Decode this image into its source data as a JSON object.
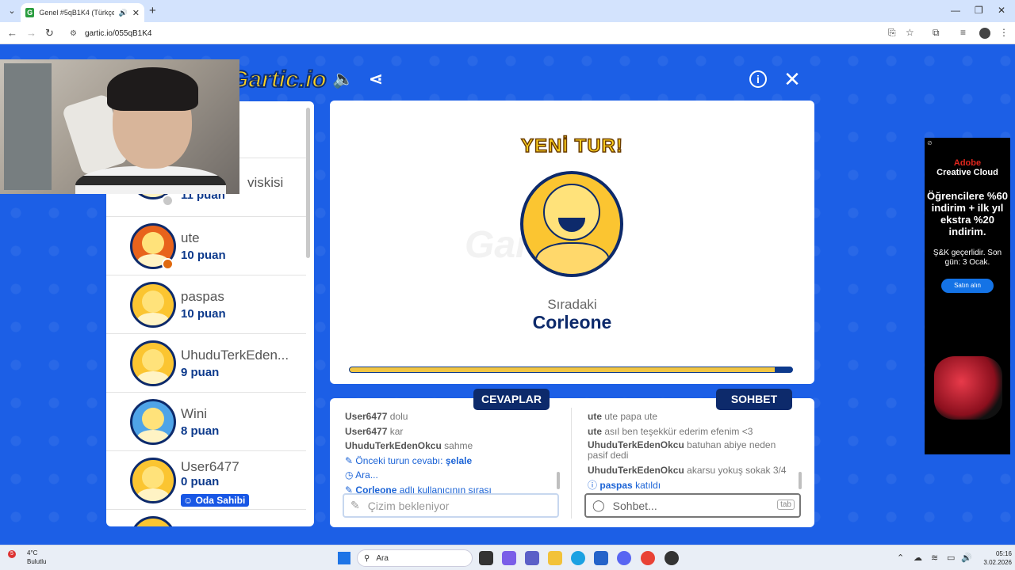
{
  "browser": {
    "tab_title": "Genel #5qB1K4 (Türkçe) - G",
    "url": "gartic.io/055qB1K4"
  },
  "game": {
    "logo": "Gartic.io",
    "players": [
      {
        "name": "",
        "name_suffix": "viskisi",
        "score": "11 puan",
        "avatar": "yellow",
        "status_color": "#c8c8c8"
      },
      {
        "name": "ute",
        "score": "10 puan",
        "avatar": "orange",
        "status_color": "#e06a10"
      },
      {
        "name": "paspas",
        "score": "10 puan",
        "avatar": "yellow",
        "status_color": ""
      },
      {
        "name": "UhuduTerkEden...",
        "score": "9 puan",
        "avatar": "yellow",
        "status_color": ""
      },
      {
        "name": "Wini",
        "score": "8 puan",
        "avatar": "blue",
        "status_color": ""
      },
      {
        "name": "User6477",
        "score": "0 puan",
        "avatar": "yellow",
        "status_color": "",
        "badge": "Oda Sahibi"
      }
    ],
    "round": {
      "title": "YENİ TUR!",
      "next_label": "Sıradaki",
      "next_player": "Corleone",
      "progress": 0.96
    },
    "answers": {
      "tab_label": "CEVAPLAR",
      "lines": [
        {
          "user": "User6477",
          "text": "dolu"
        },
        {
          "user": "User6477",
          "text": "kar"
        },
        {
          "user": "UhuduTerkEdenOkcu",
          "text": "sahme"
        }
      ],
      "prev_answer_prefix": "Önceki turun cevabı:",
      "prev_answer": "şelale",
      "hint": "Ara...",
      "turn_user": "Corleone",
      "turn_suffix": "adlı kullanıcının sırası",
      "input_placeholder": "Çizim bekleniyor"
    },
    "chat": {
      "tab_label": "SOHBET",
      "lines": [
        {
          "user": "ute",
          "text": "ute papa ute"
        },
        {
          "user": "ute",
          "text": "asıl ben teşekkür ederim efenim <3"
        },
        {
          "user": "UhuduTerkEdenOkcu",
          "text": "batuhan abiye neden pasif dedi"
        },
        {
          "user": "UhuduTerkEdenOkcu",
          "text": "akarsu yokuş sokak 3/4"
        }
      ],
      "join_user": "paspas",
      "join_text": "katıldı",
      "input_placeholder": "Sohbet...",
      "tab_key": "tab"
    }
  },
  "ad": {
    "brand": "Adobe",
    "product": "Creative Cloud",
    "headline": "Öğrencilere %60 indirim + ilk yıl ekstra %20 indirim.",
    "terms": "Ş&K geçerlidir. Son gün: 3 Ocak.",
    "cta": "Satın alın"
  },
  "taskbar": {
    "temp": "4°C",
    "weather": "Bulutlu",
    "search": "Ara",
    "time": "05:16",
    "date": "3.02.2026"
  }
}
